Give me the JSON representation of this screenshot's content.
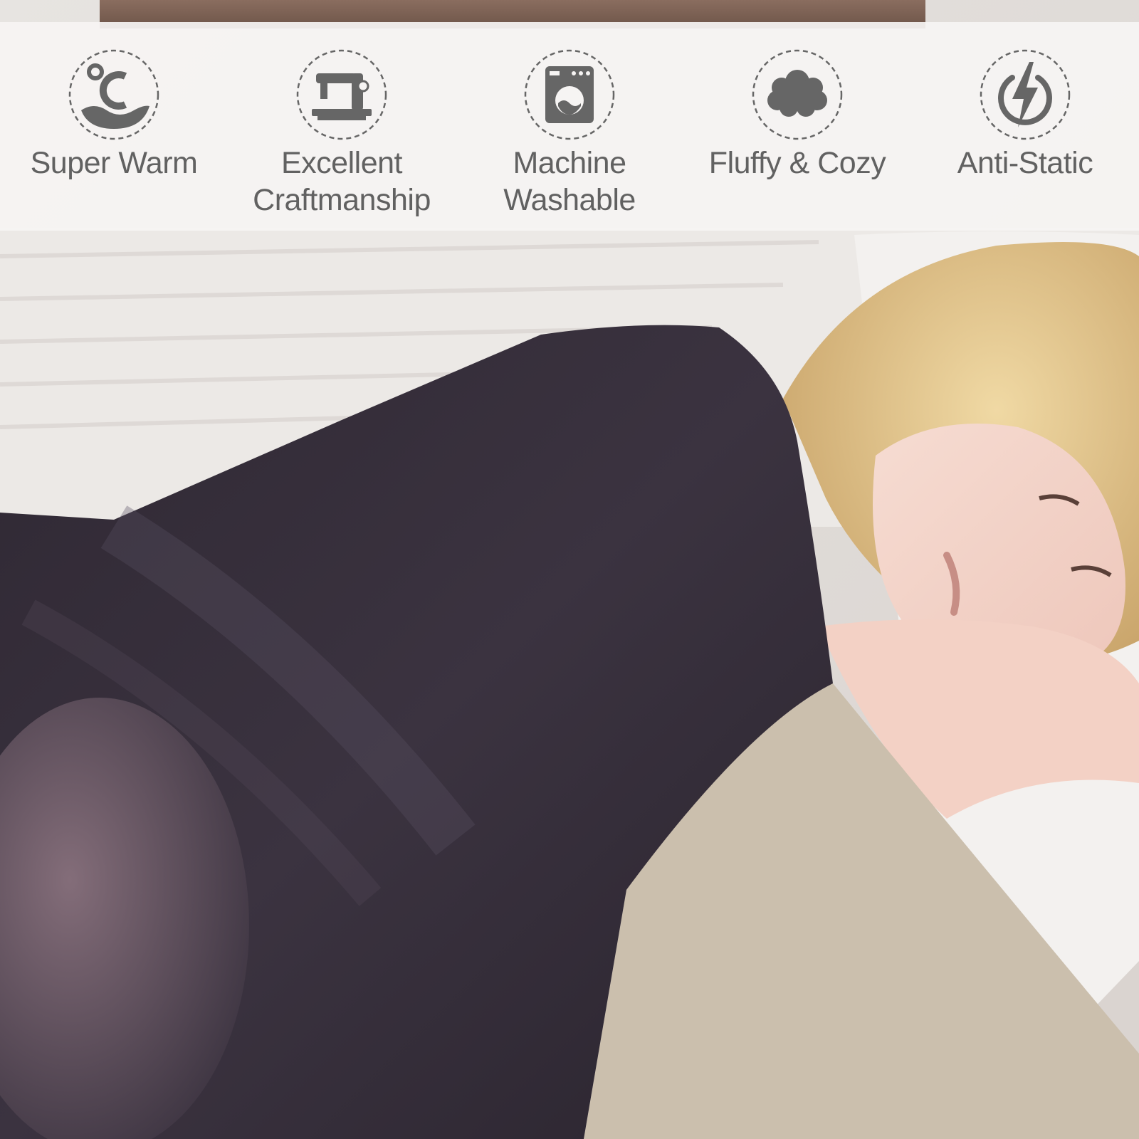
{
  "features": [
    {
      "icon": "thermometer-warm-icon",
      "label": "Super Warm"
    },
    {
      "icon": "sewing-machine-icon",
      "label": "Excellent\nCraftmanship"
    },
    {
      "icon": "washing-machine-icon",
      "label": "Machine\nWashable"
    },
    {
      "icon": "cloud-icon",
      "label": "Fluffy & Cozy"
    },
    {
      "icon": "lightning-bolt-icon",
      "label": "Anti-Static"
    }
  ],
  "colors": {
    "icon": "#666666",
    "label": "#616161",
    "banner": "#f6f4f3",
    "blanket": "#3b3340"
  }
}
